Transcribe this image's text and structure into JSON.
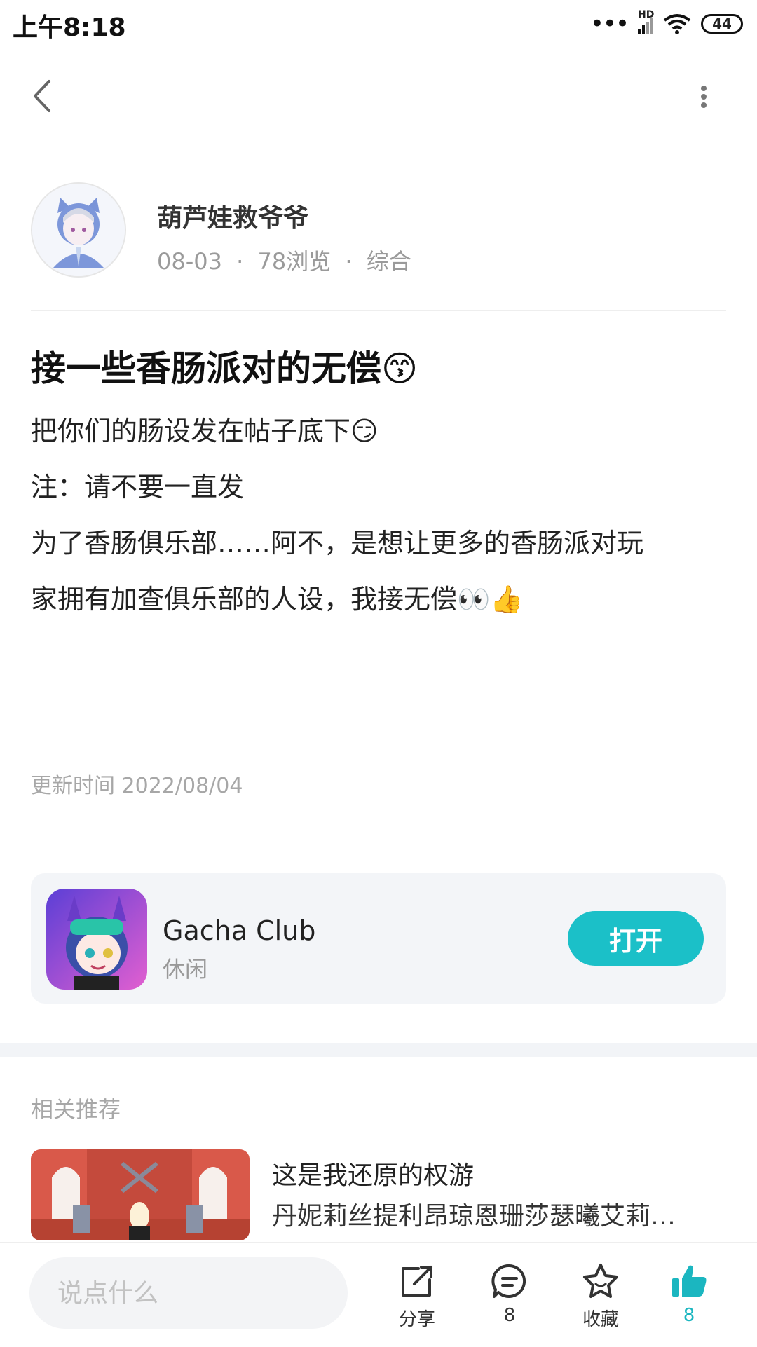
{
  "status_bar": {
    "time": "上午8:18",
    "battery": "44",
    "network": "HD"
  },
  "author": {
    "name": "葫芦娃救爷爷",
    "date": "08-03",
    "views": "78浏览",
    "category": "综合",
    "sep": "·"
  },
  "post": {
    "title": "接一些香肠派对的无偿😙",
    "lines": [
      "把你们的肠设发在帖子底下😏",
      "注：请不要一直发",
      "为了香肠俱乐部……阿不，是想让更多的香肠派对玩",
      "家拥有加查俱乐部的人设，我接无偿👀👍"
    ],
    "updated": "更新时间 2022/08/04"
  },
  "app_card": {
    "name": "Gacha Club",
    "category": "休闲",
    "open_label": "打开"
  },
  "related": {
    "label": "相关推荐",
    "items": [
      {
        "title": "这是我还原的权游",
        "subtitle": "丹妮莉丝提利昂琼恩珊莎瑟曦艾莉…"
      }
    ]
  },
  "bottom_bar": {
    "input_placeholder": "说点什么",
    "share_label": "分享",
    "comment_count": "8",
    "favorite_label": "收藏",
    "like_count": "8"
  },
  "colors": {
    "accent": "#1bc0c8",
    "like_active": "#1bb6c0"
  }
}
